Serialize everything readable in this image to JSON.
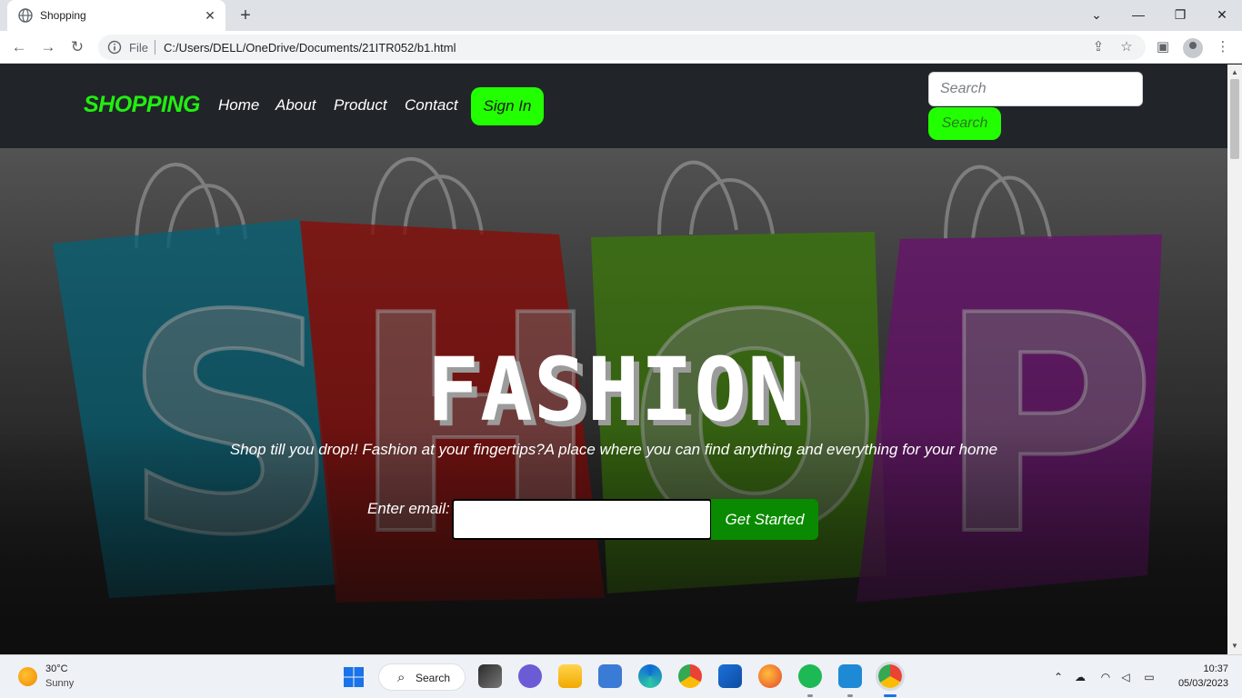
{
  "browser": {
    "tab_title": "Shopping",
    "tab_close": "✕",
    "new_tab": "+",
    "address_scheme": "File",
    "address_url": "C:/Users/DELL/OneDrive/Documents/21ITR052/b1.html",
    "window_minimize": "—",
    "window_restore": "❐",
    "window_close": "✕",
    "tab_search": "⌄"
  },
  "site": {
    "brand": "SHOPPING",
    "nav": [
      "Home",
      "About",
      "Product",
      "Contact"
    ],
    "signin_label": "Sign In",
    "search_placeholder": "Search",
    "search_button": "Search",
    "accent_color": "#22ff00"
  },
  "hero": {
    "headline": "FASHION",
    "tagline": "Shop till you drop!! Fashion at your fingertips?A place where you can find anything and everything for your home",
    "email_label": "Enter email:",
    "email_value": "",
    "cta_label": "Get Started",
    "background_letters": [
      "S",
      "H",
      "O",
      "P"
    ]
  },
  "taskbar": {
    "weather_temp": "30°C",
    "weather_desc": "Sunny",
    "search_label": "Search",
    "time": "10:37",
    "date": "05/03/2023",
    "apps": [
      "task-view",
      "teams-chat",
      "file-explorer",
      "notepad",
      "edge",
      "chrome",
      "microsoft-store",
      "firefox",
      "spotify",
      "vscode",
      "chrome-active"
    ]
  }
}
